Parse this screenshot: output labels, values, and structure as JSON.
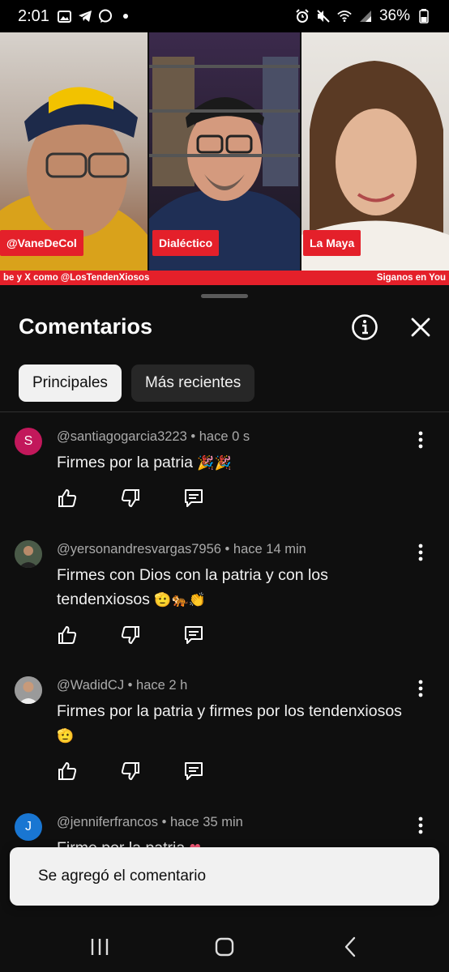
{
  "status_bar": {
    "time": "2:01",
    "battery": "36%",
    "left_icons": [
      "image-icon",
      "telegram-icon",
      "whatsapp-icon",
      "dot-icon"
    ],
    "right_icons": [
      "alarm-icon",
      "mute-icon",
      "wifi-icon",
      "signal-icon"
    ]
  },
  "video": {
    "participants": [
      {
        "name": "@VaneDeCol"
      },
      {
        "name": "Dialéctico"
      },
      {
        "name": "La Maya"
      }
    ],
    "ticker_left": "be y X como @LosTendenXiosos",
    "ticker_right": "Siganos en You"
  },
  "sheet": {
    "title": "Comentarios",
    "chips": [
      {
        "label": "Principales",
        "active": true
      },
      {
        "label": "Más recientes",
        "active": false
      }
    ]
  },
  "comments": [
    {
      "author": "@santiagogarcia3223",
      "time": "hace 0 s",
      "text": "Firmes por la patria",
      "emoji": "🎉🎉",
      "avatar_letter": "S",
      "avatar_color": "#c2185b"
    },
    {
      "author": "@yersonandresvargas7956",
      "time": "hace 14 min",
      "text": "Firmes con Dios con la patria y con los tendenxiosos",
      "emoji": "🫡🐅👏",
      "avatar_letter": "",
      "avatar_color": "#3a4a3a"
    },
    {
      "author": "@WadidCJ",
      "time": "hace 2 h",
      "text": "Firmes por la patria y firmes por los tendenxiosos",
      "emoji": "🫡",
      "avatar_letter": "",
      "avatar_color": "#8a8a8a"
    },
    {
      "author": "@jenniferfrancos",
      "time": "hace 35 min",
      "text": "Firme por la patria",
      "emoji": "❤",
      "avatar_letter": "J",
      "avatar_color": "#1976d2"
    }
  ],
  "toast": {
    "message": "Se agregó el comentario"
  },
  "colors": {
    "accent_red": "#e4202a",
    "background": "#0f0f0f",
    "chip_active": "#f1f1f1",
    "chip_inactive": "#272727"
  }
}
